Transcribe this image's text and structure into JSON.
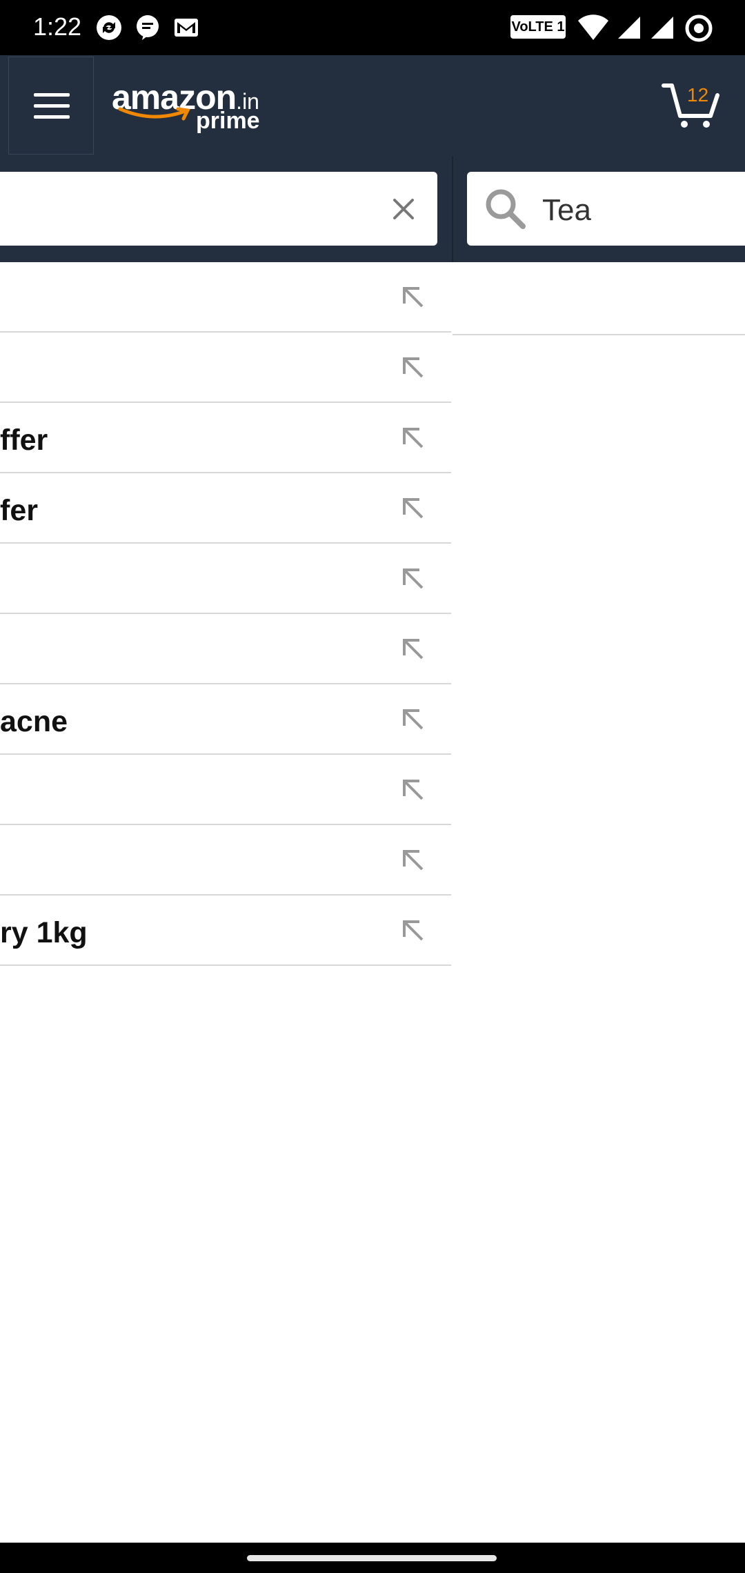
{
  "status_bar": {
    "time": "1:22",
    "network_badge": "VoLTE 1",
    "icons": [
      "sync-icon",
      "message-icon",
      "gmail-icon",
      "volte-icon",
      "wifi-icon",
      "signal-icon",
      "signal-icon",
      "data-saver-icon"
    ]
  },
  "header": {
    "logo_word": "amazon",
    "logo_tld": ".in",
    "logo_sub": "prime",
    "cart_count": "12"
  },
  "search": {
    "left_value": "",
    "right_value": "Tea"
  },
  "suggestions": [
    {
      "text": ""
    },
    {
      "text": ""
    },
    {
      "text": "ffer"
    },
    {
      "text": "fer"
    },
    {
      "text": ""
    },
    {
      "text": ""
    },
    {
      "text": "acne"
    },
    {
      "text": ""
    },
    {
      "text": ""
    },
    {
      "text": "ry 1kg"
    }
  ],
  "colors": {
    "header_bg": "#232f3e",
    "accent": "#f08804"
  }
}
